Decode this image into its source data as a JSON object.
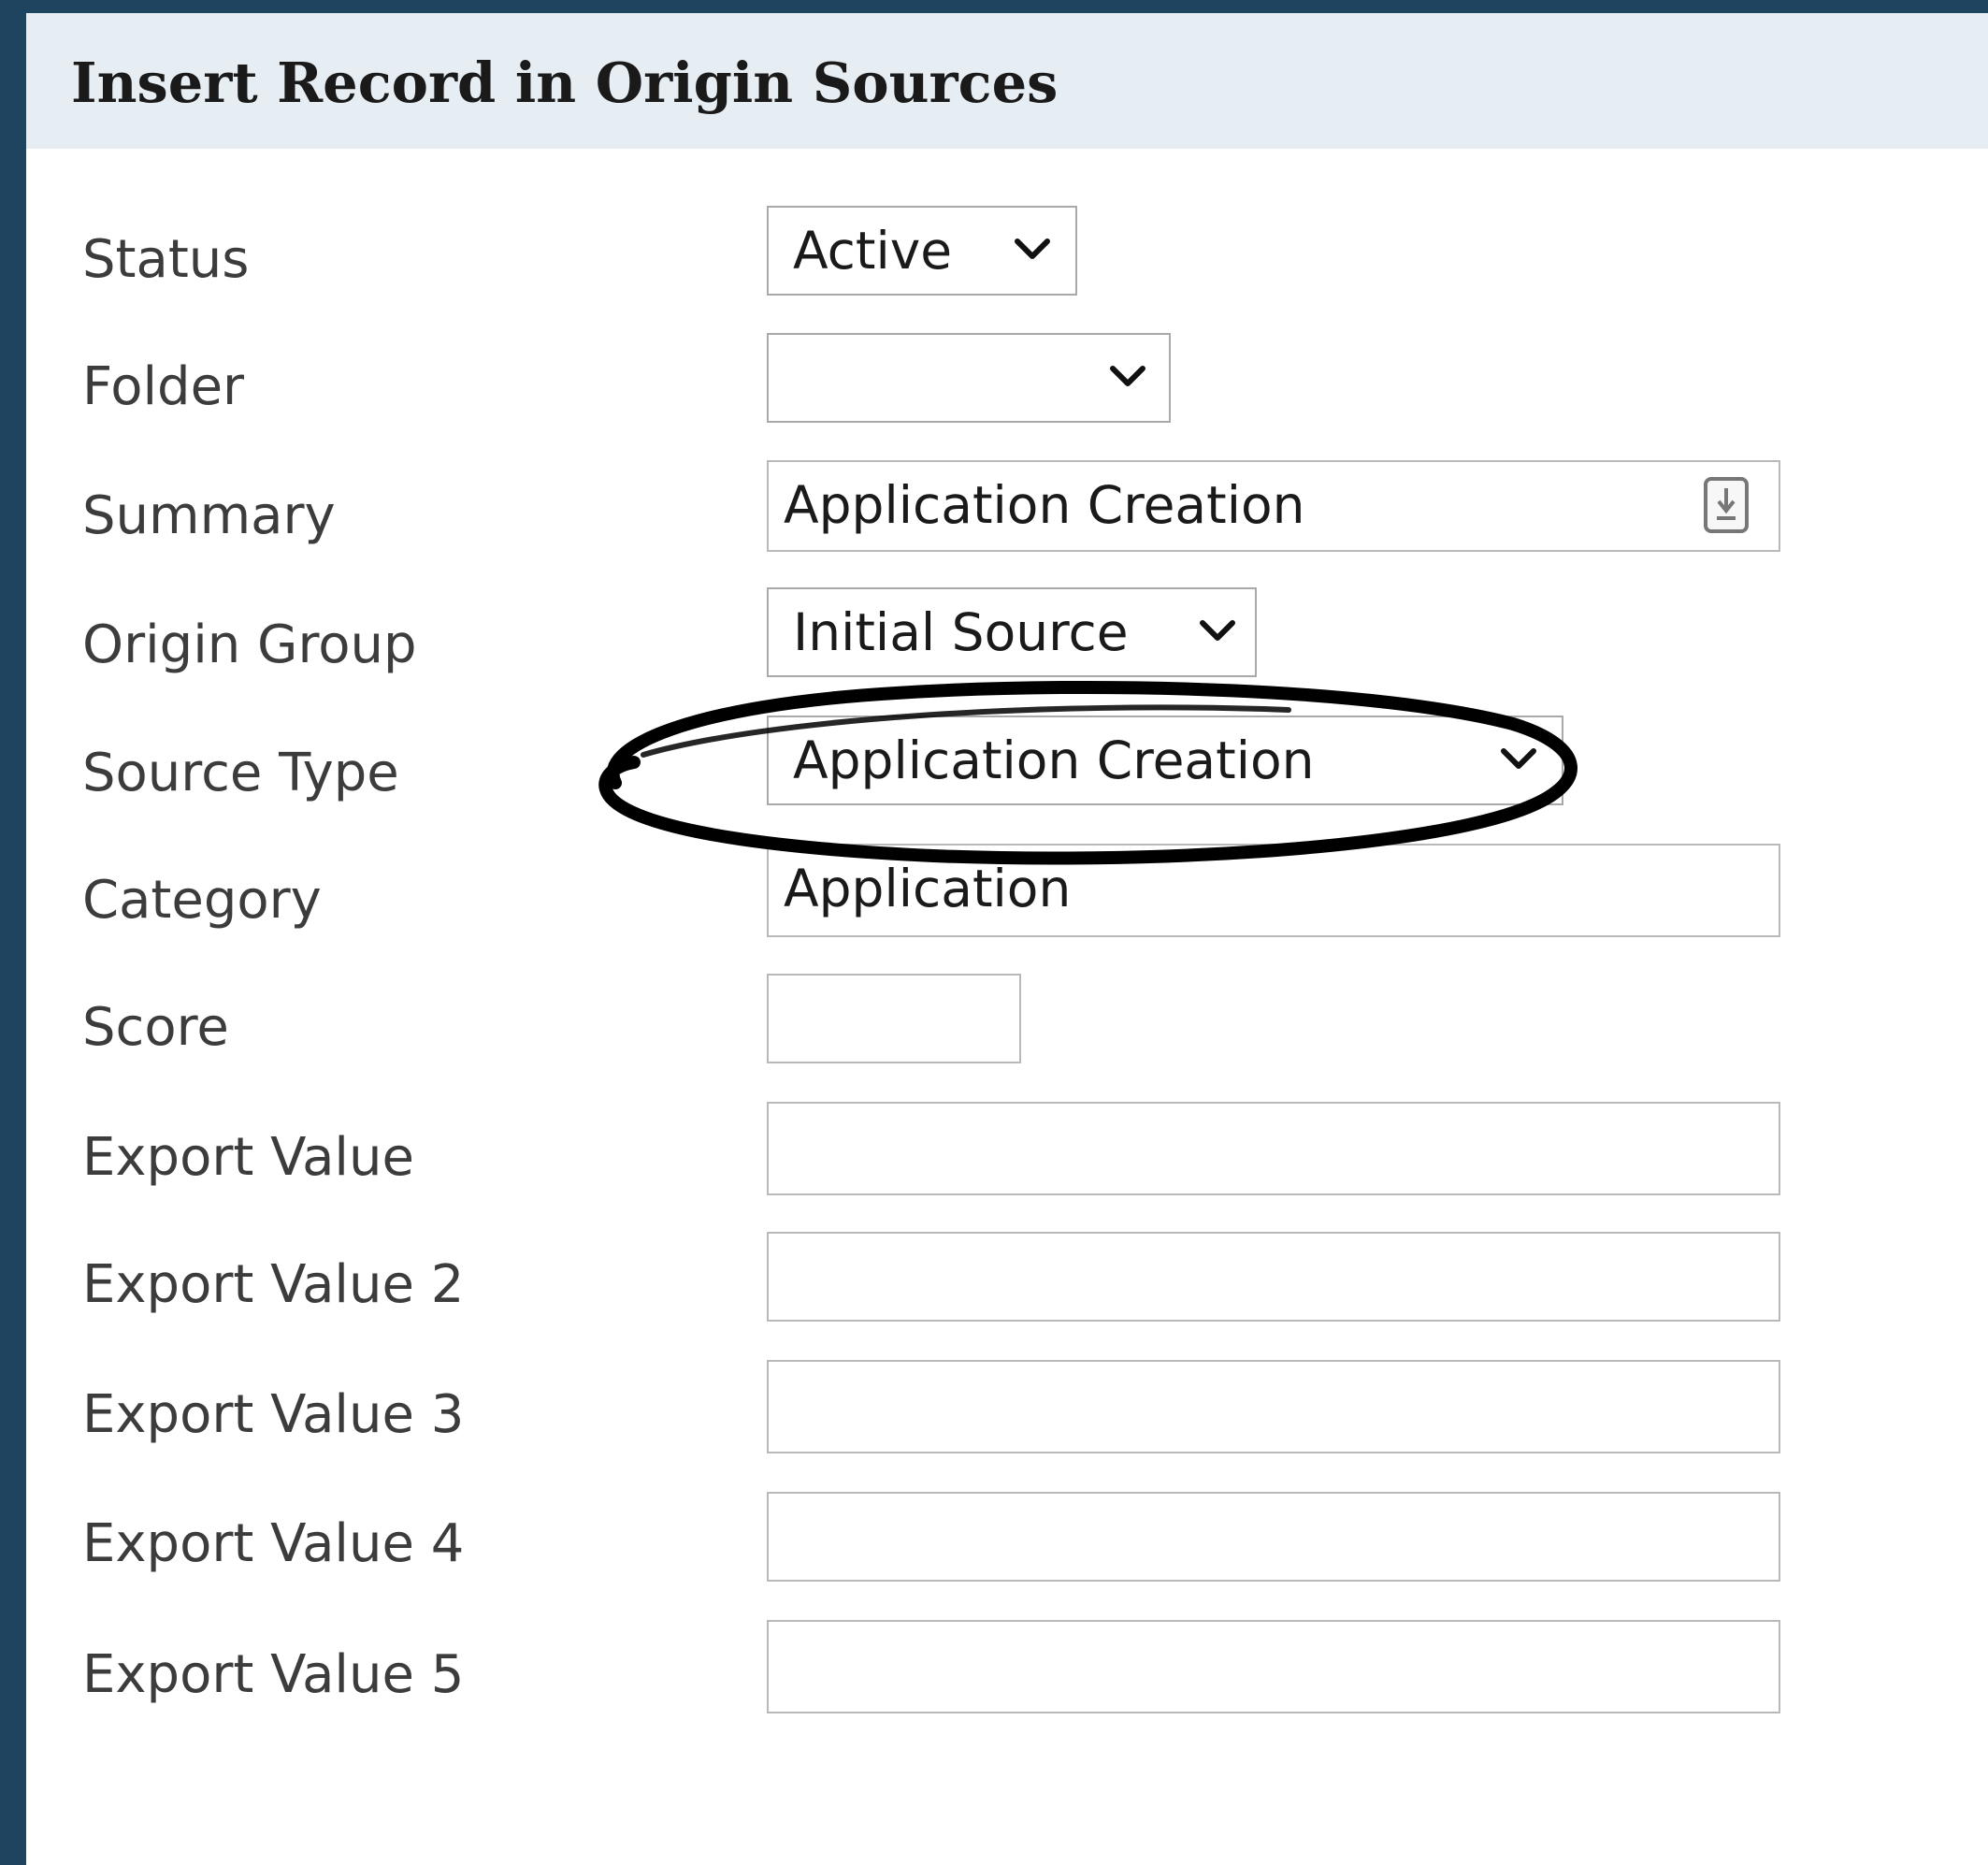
{
  "dialog": {
    "title": "Insert Record in Origin Sources"
  },
  "fields": {
    "status": {
      "label": "Status",
      "value": "Active"
    },
    "folder": {
      "label": "Folder",
      "value": ""
    },
    "summary": {
      "label": "Summary",
      "value": "Application Creation"
    },
    "origin_group": {
      "label": "Origin Group",
      "value": "Initial Source"
    },
    "source_type": {
      "label": "Source Type",
      "value": "Application Creation"
    },
    "category": {
      "label": "Category",
      "value": "Application"
    },
    "score": {
      "label": "Score",
      "value": ""
    },
    "export_value": {
      "label": "Export Value",
      "value": ""
    },
    "export_value_2": {
      "label": "Export Value 2",
      "value": ""
    },
    "export_value_3": {
      "label": "Export Value 3",
      "value": ""
    },
    "export_value_4": {
      "label": "Export Value 4",
      "value": ""
    },
    "export_value_5": {
      "label": "Export Value 5",
      "value": ""
    }
  },
  "icons": {
    "dropdown": "chevron-down-icon",
    "summary_expand": "expand-text-icon",
    "annotation": "hand-drawn-ellipse"
  },
  "colors": {
    "frame": "#1f4460",
    "header_bg": "#e7eef3",
    "field_border": "#b9b9b9",
    "annotation_stroke": "#000000"
  }
}
